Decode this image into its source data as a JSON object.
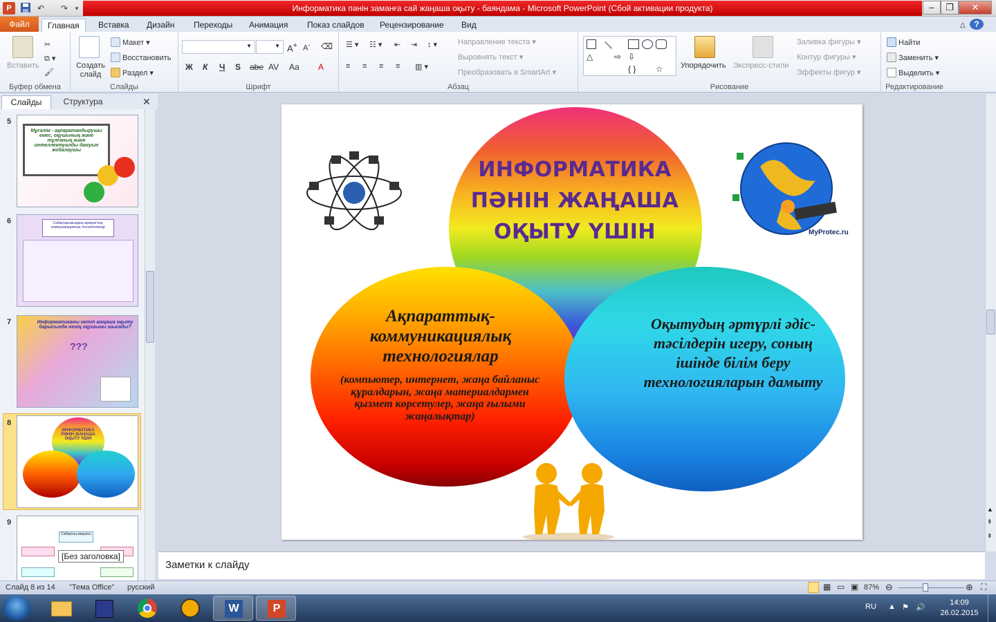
{
  "window": {
    "title": "Информатика пәнін заманға сай жаңаша оқыту - баяндама  -  Microsoft PowerPoint (Сбой активации продукта)",
    "app_logo": "P",
    "quick_access": [
      "save-icon",
      "undo-icon",
      "redo-icon"
    ],
    "controls": {
      "minimize": "–",
      "restore": "❐",
      "close": "✕"
    }
  },
  "ribbon_tabs": [
    "Файл",
    "Главная",
    "Вставка",
    "Дизайн",
    "Переходы",
    "Анимация",
    "Показ слайдов",
    "Рецензирование",
    "Вид"
  ],
  "ribbon": {
    "clipboard": {
      "paste": "Вставить",
      "label": "Буфер обмена"
    },
    "slides": {
      "new_slide": "Создать слайд",
      "layout": "Макет ▾",
      "reset": "Восстановить",
      "section": "Раздел ▾",
      "label": "Слайды"
    },
    "font": {
      "label": "Шрифт",
      "buttons": [
        "Ж",
        "К",
        "Ч",
        "S",
        "abe",
        "AV",
        "Aa",
        "A"
      ]
    },
    "paragraph": {
      "text_direction": "Направление текста ▾",
      "align_text": "Выровнять текст ▾",
      "smartart": "Преобразовать в SmartArt ▾",
      "label": "Абзац"
    },
    "drawing": {
      "arrange": "Упорядочить",
      "quick_styles": "Экспресс-стили",
      "fill": "Заливка фигуры ▾",
      "outline": "Контур фигуры ▾",
      "effects": "Эффекты фигур ▾",
      "label": "Рисование"
    },
    "editing": {
      "find": "Найти",
      "replace": "Заменить ▾",
      "select": "Выделить ▾",
      "label": "Редактирование"
    }
  },
  "left_pane": {
    "tabs": [
      "Слайды",
      "Структура"
    ],
    "close": "✕",
    "thumbnails": [
      {
        "num": "5",
        "text": "Мұғалім - ақпаратандырушы емес, оқушының және тұлғаның және интеллектуалды дамуын жобалаушы"
      },
      {
        "num": "6",
        "text": "Сабақтарымыздың ақпараттық-коммуникациялық технологиялар"
      },
      {
        "num": "7",
        "text": "Информатиканы нетіп жаңаша оқыту барысында ненің оқушыны шығады?"
      },
      {
        "num": "8",
        "text": "ИНФОРМАТИКА ПӘНІН ЖАҢАША ОҚЫТУ ҮШІН"
      },
      {
        "num": "9",
        "text": "Сабақтың мақсаты"
      }
    ],
    "selected": "8",
    "tooltip": "[Без заголовка]"
  },
  "slide": {
    "title": "ИНФОРМАТИКА ПӘНІН ЖАҢАША ОҚЫТУ ҮШІН",
    "left_heading": "Ақпараттық-коммуникациялық технологиялар",
    "left_sub": "(компьютер, интернет, жаңа байланыс құралдарын, жаңа материалдармен қызмет көрсетулер, жаңа ғылыми жаңалықтар)",
    "right_text": "Оқытудың әртүрлі әдіс-тәсілдерін игеру, соның ішінде білім беру технологияларын дамыту",
    "globe_label": "MyProtec.ru"
  },
  "notes": {
    "placeholder": "Заметки к слайду"
  },
  "status": {
    "slide_info": "Слайд 8 из 14",
    "theme": "\"Тема Office\"",
    "language": "русский",
    "zoom": "87%",
    "zoom_level": 0.87
  },
  "taskbar": {
    "apps": [
      "explorer-icon",
      "save-icon",
      "chrome-icon",
      "aimp-icon",
      "word-icon",
      "powerpoint-icon"
    ],
    "lang": "RU",
    "time": "14:09",
    "date": "26.02.2015"
  },
  "colors": {
    "title_red": "#d00000",
    "file_tab": "#e36c24",
    "selected_thumb": "#fce08a",
    "title_text": "#5a2a90"
  }
}
